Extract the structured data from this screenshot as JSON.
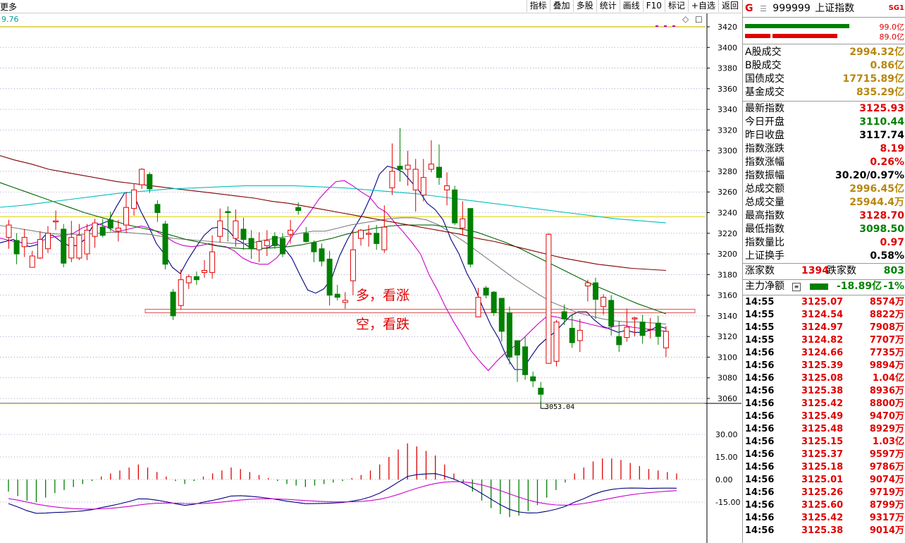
{
  "toolbar": {
    "more_label": "更多",
    "buttons": [
      "指标",
      "叠加",
      "多股",
      "统计",
      "画线",
      "F10",
      "标记",
      "+自选",
      "返回"
    ]
  },
  "chart": {
    "ma_label": "9.76",
    "price_axis": [
      "3420",
      "3400",
      "3380",
      "3360",
      "3340",
      "3320",
      "3300",
      "3280",
      "3260",
      "3240",
      "3220",
      "3200",
      "3180",
      "3160",
      "3140",
      "3120",
      "3100",
      "3080",
      "3060"
    ],
    "macd_axis": [
      "30.00",
      "15.00",
      "0.00",
      "-15.00"
    ],
    "low_label": "3053.04",
    "annotations": {
      "bull": "多，看涨",
      "bear": "空，看跌"
    },
    "colors": {
      "up": "#e00000",
      "down": "#008000",
      "ma5": "#000080",
      "ma10": "#cc00cc",
      "ma20": "#808080",
      "ma30": "#006400",
      "ma60": "#800000",
      "ma120": "#00c0c0"
    }
  },
  "chart_data": {
    "type": "candlestick",
    "ylim": [
      3040,
      3430
    ],
    "support_line": 3145,
    "low_marker": 3053.04,
    "candles": [
      [
        3216,
        3228,
        3233,
        3205
      ],
      [
        3213,
        3200,
        3220,
        3190
      ],
      [
        3207,
        3216,
        3224,
        3197
      ],
      [
        3187,
        3198,
        3203,
        3190
      ],
      [
        3196,
        3214,
        3222,
        3195
      ],
      [
        3205,
        3220,
        3227,
        3201
      ],
      [
        3231,
        3232,
        3242,
        3223
      ],
      [
        3224,
        3191,
        3229,
        3187
      ],
      [
        3196,
        3216,
        3232,
        3192
      ],
      [
        3196,
        3218,
        3229,
        3194
      ],
      [
        3200,
        3223,
        3229,
        3194
      ],
      [
        3217,
        3230,
        3234,
        3206
      ],
      [
        3226,
        3218,
        3234,
        3216
      ],
      [
        3233,
        3225,
        3241,
        3222
      ],
      [
        3222,
        3225,
        3233,
        3212
      ],
      [
        3228,
        3245,
        3260,
        3220
      ],
      [
        3244,
        3262,
        3268,
        3237
      ],
      [
        3267,
        3282,
        3283,
        3263
      ],
      [
        3277,
        3263,
        3279,
        3259
      ],
      [
        3248,
        3240,
        3252,
        3231
      ],
      [
        3229,
        3190,
        3232,
        3185
      ],
      [
        3163,
        3140,
        3166,
        3136
      ],
      [
        3150,
        3175,
        3185,
        3146
      ],
      [
        3172,
        3178,
        3180,
        3166
      ],
      [
        3178,
        3175,
        3183,
        3170
      ],
      [
        3182,
        3184,
        3194,
        3177
      ],
      [
        3182,
        3202,
        3218,
        3176
      ],
      [
        3217,
        3232,
        3244,
        3211
      ],
      [
        3241,
        3240,
        3246,
        3212
      ],
      [
        3215,
        3232,
        3243,
        3207
      ],
      [
        3224,
        3214,
        3235,
        3204
      ],
      [
        3215,
        3205,
        3223,
        3195
      ],
      [
        3204,
        3212,
        3221,
        3192
      ],
      [
        3208,
        3213,
        3223,
        3198
      ],
      [
        3217,
        3208,
        3221,
        3205
      ],
      [
        3215,
        3200,
        3220,
        3197
      ],
      [
        3219,
        3223,
        3233,
        3210
      ],
      [
        3245,
        3242,
        3250,
        3238
      ],
      [
        3220,
        3212,
        3226,
        3211
      ],
      [
        3211,
        3202,
        3213,
        3192
      ],
      [
        3205,
        3193,
        3210,
        3188
      ],
      [
        3195,
        3160,
        3203,
        3150
      ],
      [
        3161,
        3158,
        3170,
        3155
      ],
      [
        3153,
        3155,
        3163,
        3147
      ],
      [
        3174,
        3204,
        3223,
        3160
      ],
      [
        3215,
        3223,
        3224,
        3208
      ],
      [
        3219,
        3220,
        3228,
        3207
      ],
      [
        3220,
        3210,
        3228,
        3204
      ],
      [
        3204,
        3226,
        3247,
        3201
      ],
      [
        3264,
        3280,
        3307,
        3257
      ],
      [
        3285,
        3282,
        3322,
        3270
      ],
      [
        3282,
        3286,
        3300,
        3266
      ],
      [
        3262,
        3282,
        3292,
        3241
      ],
      [
        3257,
        3274,
        3292,
        3251
      ],
      [
        3282,
        3287,
        3310,
        3279
      ],
      [
        3284,
        3274,
        3306,
        3267
      ],
      [
        3262,
        3266,
        3279,
        3247
      ],
      [
        3262,
        3230,
        3266,
        3228
      ],
      [
        3225,
        3234,
        3251,
        3218
      ],
      [
        3244,
        3190,
        3244,
        3187
      ],
      [
        3139,
        3158,
        3167,
        3139
      ],
      [
        3167,
        3160,
        3169,
        3157
      ],
      [
        3163,
        3143,
        3164,
        3140
      ],
      [
        3157,
        3125,
        3157,
        3115
      ],
      [
        3143,
        3100,
        3149,
        3093
      ],
      [
        3116,
        3102,
        3116,
        3076
      ],
      [
        3110,
        3083,
        3120,
        3078
      ],
      [
        3081,
        3077,
        3086,
        3071
      ],
      [
        3070,
        3064,
        3076,
        3053
      ],
      [
        3094,
        3219,
        3220,
        3094
      ],
      [
        3096,
        3134,
        3136,
        3091
      ],
      [
        3144,
        3137,
        3151,
        3131
      ],
      [
        3128,
        3114,
        3142,
        3109
      ],
      [
        3116,
        3126,
        3137,
        3105
      ],
      [
        3169,
        3172,
        3175,
        3154
      ],
      [
        3172,
        3156,
        3177,
        3137
      ],
      [
        3149,
        3158,
        3161,
        3141
      ],
      [
        3155,
        3130,
        3160,
        3121
      ],
      [
        3120,
        3112,
        3135,
        3105
      ],
      [
        3119,
        3129,
        3147,
        3115
      ],
      [
        3137,
        3138,
        3139,
        3120
      ],
      [
        3134,
        3121,
        3141,
        3113
      ],
      [
        3127,
        3127,
        3138,
        3118
      ],
      [
        3133,
        3120,
        3140,
        3112
      ],
      [
        3109,
        3125,
        3130,
        3100
      ]
    ],
    "ma_series": [
      {
        "name": "MA5",
        "values": [
          3210,
          3212,
          3214,
          3211,
          3207,
          3209,
          3218,
          3218,
          3212,
          3208,
          3208,
          3214,
          3227,
          3229,
          3232,
          3246,
          3259,
          3260,
          3242,
          3227,
          3210,
          3200,
          3187,
          3181,
          3195,
          3207,
          3218,
          3225,
          3226,
          3223,
          3214,
          3210,
          3205,
          3205,
          3206,
          3210,
          3206,
          3196,
          3180,
          3165,
          3162,
          3166,
          3176,
          3198,
          3214,
          3227,
          3240,
          3257,
          3277,
          3285,
          3283,
          3279,
          3270,
          3261,
          3249,
          3243,
          3233,
          3214,
          3200,
          3181,
          3167,
          3148,
          3131,
          3118,
          3100,
          3088,
          3088,
          3100,
          3111,
          3118,
          3124,
          3132,
          3140,
          3144,
          3144,
          3136,
          3130,
          3127,
          3124,
          3126,
          3124,
          3124,
          3126,
          3130,
          3128
        ]
      },
      {
        "name": "MA10",
        "values": [
          3216,
          3214,
          3212,
          3211,
          3210,
          3212,
          3215,
          3217,
          3218,
          3220,
          3225,
          3228,
          3229,
          3226,
          3221,
          3223,
          3225,
          3227,
          3225,
          3221,
          3216,
          3211,
          3208,
          3207,
          3208,
          3210,
          3208,
          3207,
          3203,
          3196,
          3192,
          3190,
          3190,
          3196,
          3206,
          3219,
          3230,
          3241,
          3253,
          3262,
          3270,
          3271,
          3266,
          3260,
          3255,
          3245,
          3240,
          3230,
          3221,
          3211,
          3200,
          3180,
          3165,
          3148,
          3133,
          3120,
          3106,
          3096,
          3087,
          3096,
          3104,
          3110,
          3117,
          3125,
          3133,
          3140,
          3139,
          3137,
          3136,
          3134,
          3132,
          3130,
          3128,
          3130,
          3131,
          3129,
          3128,
          3127,
          3126,
          3125
        ]
      },
      {
        "name": "MA20",
        "values": [
          3228,
          3226,
          3224,
          3222,
          3220,
          3219,
          3219,
          3219,
          3220,
          3221,
          3221,
          3220,
          3219,
          3217,
          3215,
          3214,
          3213,
          3212,
          3211,
          3210,
          3210,
          3213,
          3215,
          3217,
          3220,
          3222,
          3222,
          3225,
          3228,
          3230,
          3232,
          3234,
          3235,
          3235,
          3233,
          3228,
          3220,
          3212,
          3203,
          3194,
          3185,
          3176,
          3168,
          3160,
          3153,
          3148,
          3143,
          3140,
          3137,
          3135,
          3134,
          3134,
          3133,
          3132
        ]
      },
      {
        "name": "MA30",
        "values": [
          3270,
          3265,
          3260,
          3255,
          3250,
          3245,
          3240,
          3236,
          3232,
          3228,
          3225,
          3222,
          3218,
          3214,
          3211,
          3208,
          3206,
          3205,
          3205,
          3206,
          3207,
          3209,
          3212,
          3215,
          3219,
          3222,
          3225,
          3227,
          3228,
          3228,
          3228,
          3226,
          3224,
          3221,
          3216,
          3211,
          3205,
          3198,
          3191,
          3184,
          3177,
          3170,
          3164,
          3158,
          3152,
          3147,
          3142
        ]
      },
      {
        "name": "MA60",
        "values": [
          3296,
          3291,
          3287,
          3282,
          3279,
          3276,
          3273,
          3270,
          3268,
          3266,
          3264,
          3262,
          3260,
          3258,
          3256,
          3254,
          3251,
          3249,
          3246,
          3243,
          3240,
          3237,
          3234,
          3231,
          3228,
          3225,
          3222,
          3219,
          3215,
          3212,
          3208,
          3204,
          3200,
          3196,
          3193,
          3190,
          3188,
          3186,
          3185,
          3184
        ]
      },
      {
        "name": "MA120",
        "values": [
          3245,
          3247,
          3250,
          3253,
          3256,
          3259,
          3261,
          3263,
          3264,
          3265,
          3266,
          3266,
          3266,
          3265,
          3264,
          3262,
          3260,
          3258,
          3255,
          3252,
          3249,
          3246,
          3243,
          3240,
          3237,
          3234,
          3232,
          3230
        ]
      }
    ],
    "macd": {
      "ylim": [
        -27,
        33
      ],
      "bars": [
        -8,
        -11,
        -14,
        -15,
        -12,
        -9,
        -7,
        -5,
        -3,
        -1,
        2,
        4,
        6,
        8,
        10,
        8,
        5,
        2,
        -1,
        -3,
        -1,
        2,
        4,
        6,
        8,
        7,
        5,
        3,
        1,
        -1,
        -3,
        -4,
        -5,
        -4,
        -3,
        -2,
        -1,
        1,
        3,
        6,
        10,
        15,
        20,
        24,
        22,
        19,
        16,
        10,
        4,
        -2,
        -8,
        -14,
        -19,
        -23,
        -25,
        -24,
        -21,
        -17,
        -12,
        -7,
        -2,
        4,
        8,
        12,
        14,
        14,
        13,
        11,
        9,
        7,
        6,
        5,
        4
      ]
    }
  },
  "right_panel": {
    "index_code": "999999",
    "index_name": "上证指数",
    "tag_g": "G",
    "tag_sg": "SG1",
    "bar_vals": [
      "99.0亿",
      "89.0亿"
    ],
    "turnover": [
      {
        "label": "A股成交",
        "value": "2994.32亿"
      },
      {
        "label": "B股成交",
        "value": "0.86亿"
      },
      {
        "label": "国债成交",
        "value": "17715.89亿"
      },
      {
        "label": "基金成交",
        "value": "835.29亿"
      }
    ],
    "stats": [
      {
        "label": "最新指数",
        "value": "3125.93",
        "color": "#e00000"
      },
      {
        "label": "今日开盘",
        "value": "3110.44",
        "color": "#008000"
      },
      {
        "label": "昨日收盘",
        "value": "3117.74",
        "color": "#000000"
      },
      {
        "label": "指数涨跌",
        "value": "8.19",
        "color": "#e00000"
      },
      {
        "label": "指数涨幅",
        "value": "0.26%",
        "color": "#e00000"
      },
      {
        "label": "指数振幅",
        "value": "30.20/0.97%",
        "color": "#000000"
      },
      {
        "label": "总成交额",
        "value": "2996.45亿",
        "color": "#b8860b"
      },
      {
        "label": "总成交量",
        "value": "25944.4万",
        "color": "#b8860b"
      },
      {
        "label": "最高指数",
        "value": "3128.70",
        "color": "#e00000"
      },
      {
        "label": "最低指数",
        "value": "3098.50",
        "color": "#008000"
      },
      {
        "label": "指数量比",
        "value": "0.97",
        "color": "#e00000"
      },
      {
        "label": "上证换手",
        "value": "0.58%",
        "color": "#000000"
      }
    ],
    "breadth": {
      "up_label": "涨家数",
      "up": "1394",
      "down_label": "跌家数",
      "down": "803"
    },
    "flow": {
      "label": "主力净额",
      "value": "-18.89亿",
      "pct": "-1%"
    },
    "ticks": [
      {
        "t": "14:55",
        "p": "3125.07",
        "v": "8574万"
      },
      {
        "t": "14:55",
        "p": "3124.54",
        "v": "8822万"
      },
      {
        "t": "14:55",
        "p": "3124.97",
        "v": "7908万"
      },
      {
        "t": "14:55",
        "p": "3124.82",
        "v": "7707万"
      },
      {
        "t": "14:56",
        "p": "3124.66",
        "v": "7735万"
      },
      {
        "t": "14:56",
        "p": "3125.39",
        "v": "9894万"
      },
      {
        "t": "14:56",
        "p": "3125.08",
        "v": "1.04亿"
      },
      {
        "t": "14:56",
        "p": "3125.38",
        "v": "8936万"
      },
      {
        "t": "14:56",
        "p": "3125.42",
        "v": "8800万"
      },
      {
        "t": "14:56",
        "p": "3125.49",
        "v": "9470万"
      },
      {
        "t": "14:56",
        "p": "3125.48",
        "v": "8929万"
      },
      {
        "t": "14:56",
        "p": "3125.15",
        "v": "1.03亿"
      },
      {
        "t": "14:56",
        "p": "3125.37",
        "v": "9597万"
      },
      {
        "t": "14:56",
        "p": "3125.18",
        "v": "9786万"
      },
      {
        "t": "14:56",
        "p": "3125.01",
        "v": "9074万"
      },
      {
        "t": "14:56",
        "p": "3125.26",
        "v": "9719万"
      },
      {
        "t": "14:56",
        "p": "3125.60",
        "v": "8799万"
      },
      {
        "t": "14:56",
        "p": "3125.42",
        "v": "9317万"
      },
      {
        "t": "14:56",
        "p": "3125.38",
        "v": "9014万"
      }
    ]
  }
}
